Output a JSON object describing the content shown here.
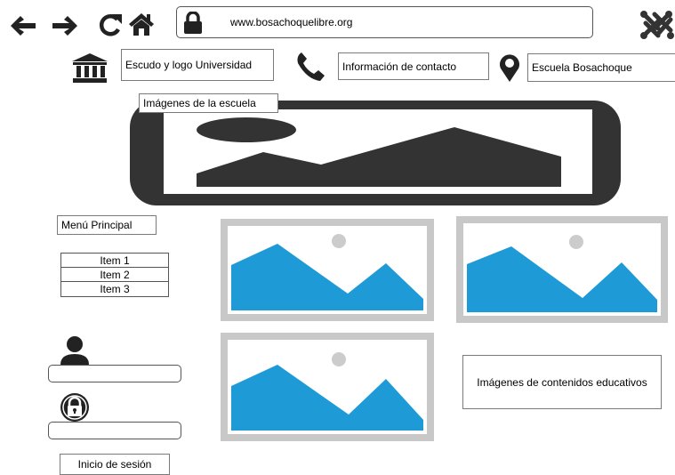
{
  "browser": {
    "url": "www.bosachoquelibre.org",
    "icons": [
      "arrow-left-icon",
      "arrow-right-icon",
      "reload-icon",
      "home-icon",
      "lock-icon",
      "joomla-logo-icon"
    ]
  },
  "header": {
    "logo_label": "Escudo y logo Universidad",
    "contact_label": "Información de contacto",
    "location_label": "Escuela Bosachoque",
    "icons": [
      "institution-icon",
      "phone-icon",
      "map-pin-icon"
    ]
  },
  "banner": {
    "label": "Imágenes de la escuela"
  },
  "sidebar": {
    "menu_title": "Menú Principal",
    "items": [
      {
        "label": "Item 1"
      },
      {
        "label": "Item 2"
      },
      {
        "label": "Item 3"
      }
    ],
    "login": {
      "username_value": "",
      "password_value": "",
      "submit_label": "Inicio de sesión",
      "icons": [
        "user-icon",
        "padlock-icon"
      ]
    }
  },
  "content": {
    "educational_label": "Imágenes de contenidos educativos"
  },
  "colors": {
    "dark": "#333333",
    "image_blue": "#1e9ad6",
    "frame_gray": "#c8c8c8",
    "sun_gray": "#cccccc"
  }
}
